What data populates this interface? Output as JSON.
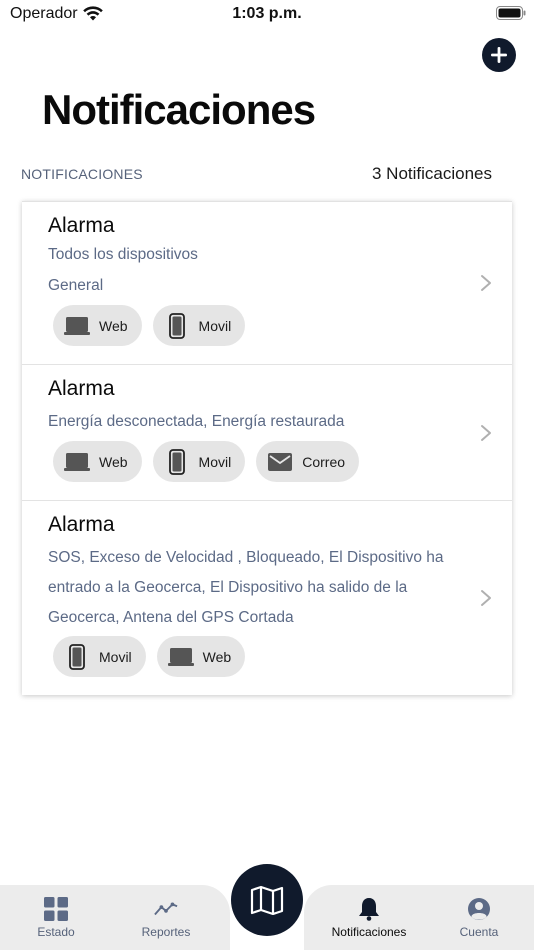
{
  "status_bar": {
    "carrier": "Operador",
    "time": "1:03 p.m."
  },
  "header": {
    "title": "Notificaciones"
  },
  "section": {
    "label": "NOTIFICACIONES",
    "count": "3 Notificaciones"
  },
  "notifications": [
    {
      "title": "Alarma",
      "events": "Todos los dispositivos",
      "group": "General",
      "channels": [
        {
          "label": "Web",
          "icon": "laptop-icon"
        },
        {
          "label": "Movil",
          "icon": "phone-icon"
        }
      ]
    },
    {
      "title": "Alarma",
      "events": "Energía desconectada, Energía restaurada",
      "channels": [
        {
          "label": "Web",
          "icon": "laptop-icon"
        },
        {
          "label": "Movil",
          "icon": "phone-icon"
        },
        {
          "label": "Correo",
          "icon": "mail-icon"
        }
      ]
    },
    {
      "title": "Alarma",
      "events_lines": [
        "SOS, Exceso de Velocidad , Bloqueado, El Dispositivo ha",
        "entrado a la Geocerca, El Dispositivo ha salido de la",
        "Geocerca, Antena del GPS Cortada"
      ],
      "channels": [
        {
          "label": "Movil",
          "icon": "phone-icon"
        },
        {
          "label": "Web",
          "icon": "laptop-icon"
        }
      ]
    }
  ],
  "tabbar": {
    "tabs": [
      {
        "label": "Estado",
        "icon": "grid-icon"
      },
      {
        "label": "Reportes",
        "icon": "chart-line-icon"
      },
      {
        "label": "Notificaciones",
        "icon": "bell-icon",
        "active": true
      },
      {
        "label": "Cuenta",
        "icon": "user-circle-icon"
      }
    ],
    "center_icon": "map-icon"
  },
  "colors": {
    "accent": "#101a2c",
    "muted_text": "#5c6a86",
    "chip_bg": "#e5e5e5",
    "tab_bg": "#ececec"
  }
}
